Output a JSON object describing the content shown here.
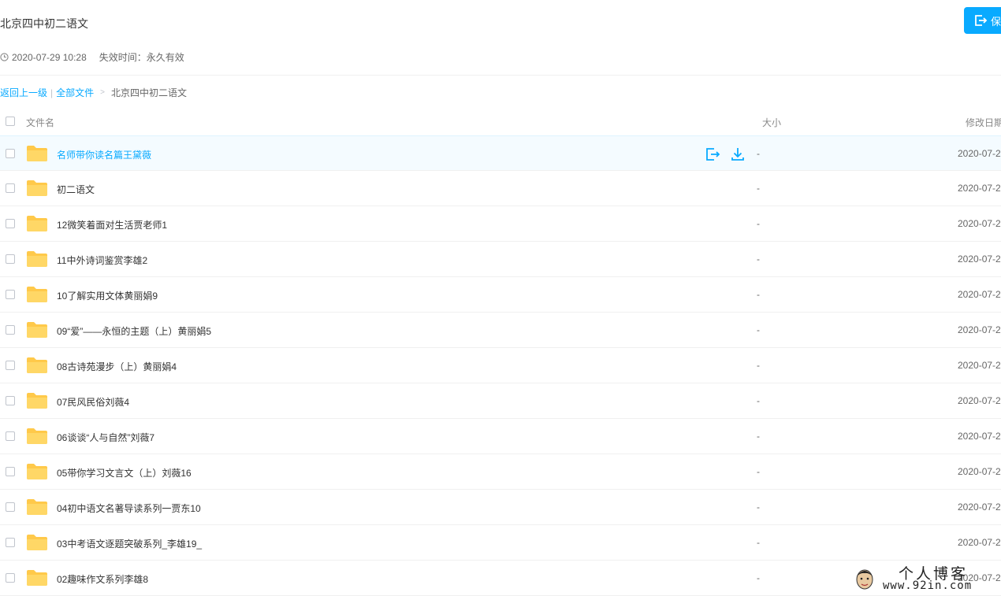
{
  "header": {
    "title": "北京四中初二语文",
    "save_label": "保",
    "created_time": "2020-07-29 10:28",
    "expire": "失效时间：永久有效"
  },
  "breadcrumb": {
    "back": "返回上一级",
    "separator": "|",
    "all_files": "全部文件",
    "arrow": ">",
    "current": "北京四中初二语文"
  },
  "table": {
    "col_name": "文件名",
    "col_size": "大小",
    "col_date": "修改日期",
    "rows": [
      {
        "name": "名师带你读名篇王黛薇",
        "size": "-",
        "date": "2020-07-2"
      },
      {
        "name": "初二语文",
        "size": "-",
        "date": "2020-07-2"
      },
      {
        "name": "12微笑着面对生活贾老师1",
        "size": "-",
        "date": "2020-07-2"
      },
      {
        "name": "11中外诗词鉴赏李雄2",
        "size": "-",
        "date": "2020-07-2"
      },
      {
        "name": "10了解实用文体黄丽娟9",
        "size": "-",
        "date": "2020-07-2"
      },
      {
        "name": "09“爱”——永恒的主题（上）黄丽娟5",
        "size": "-",
        "date": "2020-07-2"
      },
      {
        "name": "08古诗苑漫步（上）黄丽娟4",
        "size": "-",
        "date": "2020-07-2"
      },
      {
        "name": "07民风民俗刘薇4",
        "size": "-",
        "date": "2020-07-2"
      },
      {
        "name": "06谈谈“人与自然”刘薇7",
        "size": "-",
        "date": "2020-07-2"
      },
      {
        "name": "05带你学习文言文（上）刘薇16",
        "size": "-",
        "date": "2020-07-2"
      },
      {
        "name": "04初中语文名著导读系列一贾东10",
        "size": "-",
        "date": "2020-07-2"
      },
      {
        "name": "03中考语文逐题突破系列_李雄19_",
        "size": "-",
        "date": "2020-07-2"
      },
      {
        "name": "02趣味作文系列李雄8",
        "size": "-",
        "date": "2020-07-2"
      }
    ]
  },
  "watermark": {
    "text": "个人博客",
    "url": "www.92in.com"
  },
  "colors": {
    "accent": "#09AAFF",
    "folder": "#FFC94A",
    "hover_row": "#f4fbff"
  }
}
